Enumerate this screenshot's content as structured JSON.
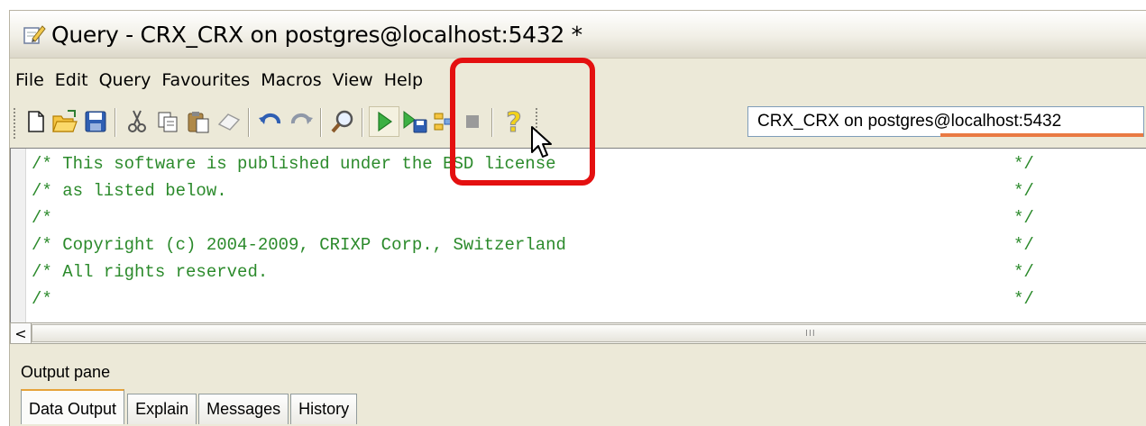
{
  "window": {
    "title": "Query - CRX_CRX on postgres@localhost:5432 *"
  },
  "menu": [
    "File",
    "Edit",
    "Query",
    "Favourites",
    "Macros",
    "View",
    "Help"
  ],
  "toolbar": {
    "connection": "CRX_CRX on postgres@localhost:5432"
  },
  "editor": {
    "lines": [
      {
        "text": "/* This software is published under the BSD license",
        "end": "*/"
      },
      {
        "text": "/* as listed below.",
        "end": "*/"
      },
      {
        "text": "/*",
        "end": "*/"
      },
      {
        "text": "/* Copyright (c) 2004-2009, CRIXP Corp., Switzerland",
        "end": "*/"
      },
      {
        "text": "/* All rights reserved.",
        "end": "*/"
      },
      {
        "text": "/*",
        "end": "*/"
      }
    ]
  },
  "scrollbar": {
    "left_arrow": "<",
    "grip": "III"
  },
  "output": {
    "label": "Output pane",
    "tabs": [
      "Data Output",
      "Explain",
      "Messages",
      "History"
    ],
    "active_tab": "Data Output"
  },
  "colors": {
    "comment": "#2b8a2b",
    "highlight": "#e41010",
    "accent": "#e97a43"
  },
  "icons": [
    "pencil-icon",
    "new-file-icon",
    "open-folder-icon",
    "save-icon",
    "cut-icon",
    "copy-icon",
    "paste-icon",
    "clear-icon",
    "undo-icon",
    "redo-icon",
    "find-icon",
    "execute-icon",
    "execute-to-file-icon",
    "explain-icon",
    "stop-icon",
    "help-icon",
    "mouse-cursor-icon"
  ]
}
